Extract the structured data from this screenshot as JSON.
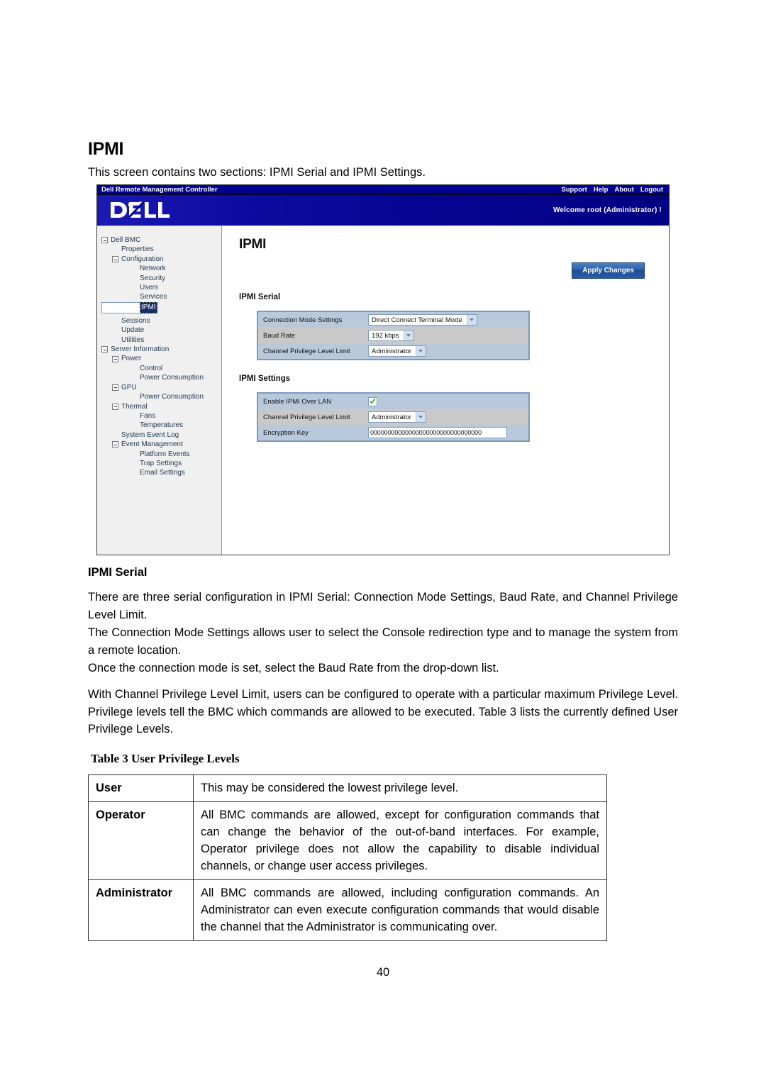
{
  "document": {
    "heading": "IPMI",
    "intro": "This screen contains two sections: IPMI Serial and IPMI Settings.",
    "section_heading": "IPMI Serial",
    "paragraphs": [
      "There are three serial configuration in IPMI Serial: Connection Mode Settings, Baud Rate, and Channel Privilege Level Limit.",
      "The Connection Mode Settings allows user to select the Console redirection type and to manage the system from a remote location.",
      "Once the connection mode is set, select the Baud Rate from the drop-down list.",
      "With Channel Privilege Level Limit, users can be configured to operate with a particular maximum Privilege Level. Privilege levels tell the BMC which commands are allowed to be executed. Table 3 lists the currently defined User Privilege Levels."
    ],
    "table_caption": "Table 3 User Privilege Levels",
    "privilege_table": {
      "rows": [
        {
          "level": "User",
          "description": "This may be considered the lowest privilege level."
        },
        {
          "level": "Operator",
          "description": "All BMC commands are allowed, except for configuration commands that can change the behavior of the out-of-band interfaces. For example, Operator privilege does not allow the capability to disable individual channels, or change user access privileges."
        },
        {
          "level": "Administrator",
          "description": "All BMC commands are allowed, including configuration commands. An Administrator can even execute configuration commands that would disable the channel that the Administrator is communicating over."
        }
      ]
    },
    "page_number": "40"
  },
  "screenshot": {
    "titlebar": {
      "app_name": "Dell Remote Management Controller",
      "links": [
        "Support",
        "Help",
        "About",
        "Logout"
      ]
    },
    "brandbar": {
      "logo_text": "DELL",
      "welcome": "Welcome root (Administrator) !"
    },
    "sidebar": {
      "items": [
        {
          "label": "Dell BMC",
          "indent": 0,
          "twisty": true,
          "selected": false
        },
        {
          "label": "Properties",
          "indent": 1,
          "twisty": false,
          "selected": false
        },
        {
          "label": "Configuration",
          "indent": 1,
          "twisty": true,
          "selected": false
        },
        {
          "label": "Network",
          "indent": 3,
          "twisty": false,
          "selected": false
        },
        {
          "label": "Security",
          "indent": 3,
          "twisty": false,
          "selected": false
        },
        {
          "label": "Users",
          "indent": 3,
          "twisty": false,
          "selected": false
        },
        {
          "label": "Services",
          "indent": 3,
          "twisty": false,
          "selected": false
        },
        {
          "label": "IPMI",
          "indent": 3,
          "twisty": false,
          "selected": true
        },
        {
          "label": "Sessions",
          "indent": 1,
          "twisty": false,
          "selected": false
        },
        {
          "label": "Update",
          "indent": 1,
          "twisty": false,
          "selected": false
        },
        {
          "label": "Utilities",
          "indent": 1,
          "twisty": false,
          "selected": false
        },
        {
          "label": "Server Information",
          "indent": 0,
          "twisty": true,
          "selected": false
        },
        {
          "label": "Power",
          "indent": 1,
          "twisty": true,
          "selected": false
        },
        {
          "label": "Control",
          "indent": 3,
          "twisty": false,
          "selected": false
        },
        {
          "label": "Power Consumption",
          "indent": 3,
          "twisty": false,
          "selected": false
        },
        {
          "label": "GPU",
          "indent": 1,
          "twisty": true,
          "selected": false
        },
        {
          "label": "Power Consumption",
          "indent": 3,
          "twisty": false,
          "selected": false
        },
        {
          "label": "Thermal",
          "indent": 1,
          "twisty": true,
          "selected": false
        },
        {
          "label": "Fans",
          "indent": 3,
          "twisty": false,
          "selected": false
        },
        {
          "label": "Temperatures",
          "indent": 3,
          "twisty": false,
          "selected": false
        },
        {
          "label": "System Event Log",
          "indent": 1,
          "twisty": false,
          "selected": false
        },
        {
          "label": "Event Management",
          "indent": 1,
          "twisty": true,
          "selected": false
        },
        {
          "label": "Platform Events",
          "indent": 3,
          "twisty": false,
          "selected": false
        },
        {
          "label": "Trap Settings",
          "indent": 3,
          "twisty": false,
          "selected": false
        },
        {
          "label": "Email Settings",
          "indent": 3,
          "twisty": false,
          "selected": false
        }
      ]
    },
    "main": {
      "page_title": "IPMI",
      "apply_button": "Apply Changes",
      "ipmi_serial": {
        "heading": "IPMI Serial",
        "rows": [
          {
            "label": "Connection Mode Settings",
            "type": "select",
            "value": "Direct Connect Terminal Mode"
          },
          {
            "label": "Baud Rate",
            "type": "select",
            "value": "192 kbps"
          },
          {
            "label": "Channel Privilege Level Limit",
            "type": "select",
            "value": "Administrator"
          }
        ]
      },
      "ipmi_settings": {
        "heading": "IPMI Settings",
        "rows": [
          {
            "label": "Enable IPMI Over LAN",
            "type": "checkbox",
            "value": "checked"
          },
          {
            "label": "Channel Privilege Level Limit",
            "type": "select",
            "value": "Administrator"
          },
          {
            "label": "Encryption Key",
            "type": "text",
            "value": "00000000000000000000000000000000"
          }
        ]
      }
    },
    "colors": {
      "titlebar_blue": "#000080",
      "brand_blue": "#00009c",
      "row_odd": "#b9c9dc",
      "row_even": "#c9c9c9",
      "form_border": "#7b9bbd",
      "selected_item": "#15306b",
      "check_green": "#2aa02a"
    }
  }
}
